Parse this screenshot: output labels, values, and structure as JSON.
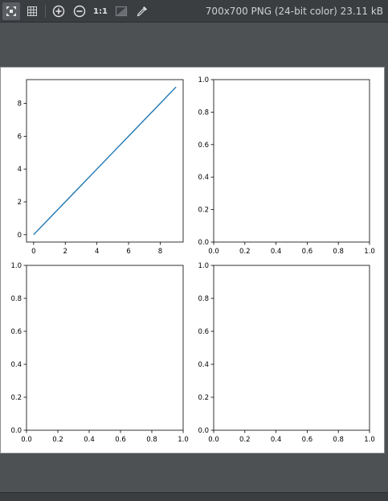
{
  "toolbar": {
    "tools": [
      {
        "icon": "fit-to-window-icon",
        "active": true
      },
      {
        "icon": "grid-icon",
        "active": false
      },
      {
        "icon": "zoom-in-icon",
        "active": false
      },
      {
        "icon": "zoom-out-icon",
        "active": false
      },
      {
        "icon": "actual-size-icon",
        "label": "1:1",
        "active": false
      },
      {
        "icon": "transparency-icon",
        "active": false
      },
      {
        "icon": "eyedropper-icon",
        "active": false
      }
    ],
    "image_info": "700x700 PNG (24-bit color) 23.11 kB"
  },
  "colors": {
    "line_series": "#1f77b4",
    "toolbar_bg": "#3b3e41",
    "app_bg": "#4d5154"
  },
  "chart_data": [
    {
      "type": "line",
      "x": [
        0,
        1,
        2,
        3,
        4,
        5,
        6,
        7,
        8,
        9
      ],
      "series": [
        {
          "values": [
            0,
            1,
            2,
            3,
            4,
            5,
            6,
            7,
            8,
            9
          ]
        }
      ],
      "xticks": [
        "0",
        "2",
        "4",
        "6",
        "8"
      ],
      "yticks": [
        "0",
        "2",
        "4",
        "6",
        "8"
      ],
      "xlim": [
        -0.45,
        9.45
      ],
      "ylim": [
        -0.45,
        9.45
      ],
      "grid": false
    },
    {
      "type": "line",
      "series": [],
      "xticks": [
        "0.0",
        "0.2",
        "0.4",
        "0.6",
        "0.8",
        "1.0"
      ],
      "yticks": [
        "0.0",
        "0.2",
        "0.4",
        "0.6",
        "0.8",
        "1.0"
      ],
      "xlim": [
        0,
        1
      ],
      "ylim": [
        0,
        1
      ],
      "grid": false
    },
    {
      "type": "line",
      "series": [],
      "xticks": [
        "0.0",
        "0.2",
        "0.4",
        "0.6",
        "0.8",
        "1.0"
      ],
      "yticks": [
        "0.0",
        "0.2",
        "0.4",
        "0.6",
        "0.8",
        "1.0"
      ],
      "xlim": [
        0,
        1
      ],
      "ylim": [
        0,
        1
      ],
      "grid": false
    },
    {
      "type": "line",
      "series": [],
      "xticks": [
        "0.0",
        "0.2",
        "0.4",
        "0.6",
        "0.8",
        "1.0"
      ],
      "yticks": [
        "0.0",
        "0.2",
        "0.4",
        "0.6",
        "0.8",
        "1.0"
      ],
      "xlim": [
        0,
        1
      ],
      "ylim": [
        0,
        1
      ],
      "grid": false
    }
  ]
}
